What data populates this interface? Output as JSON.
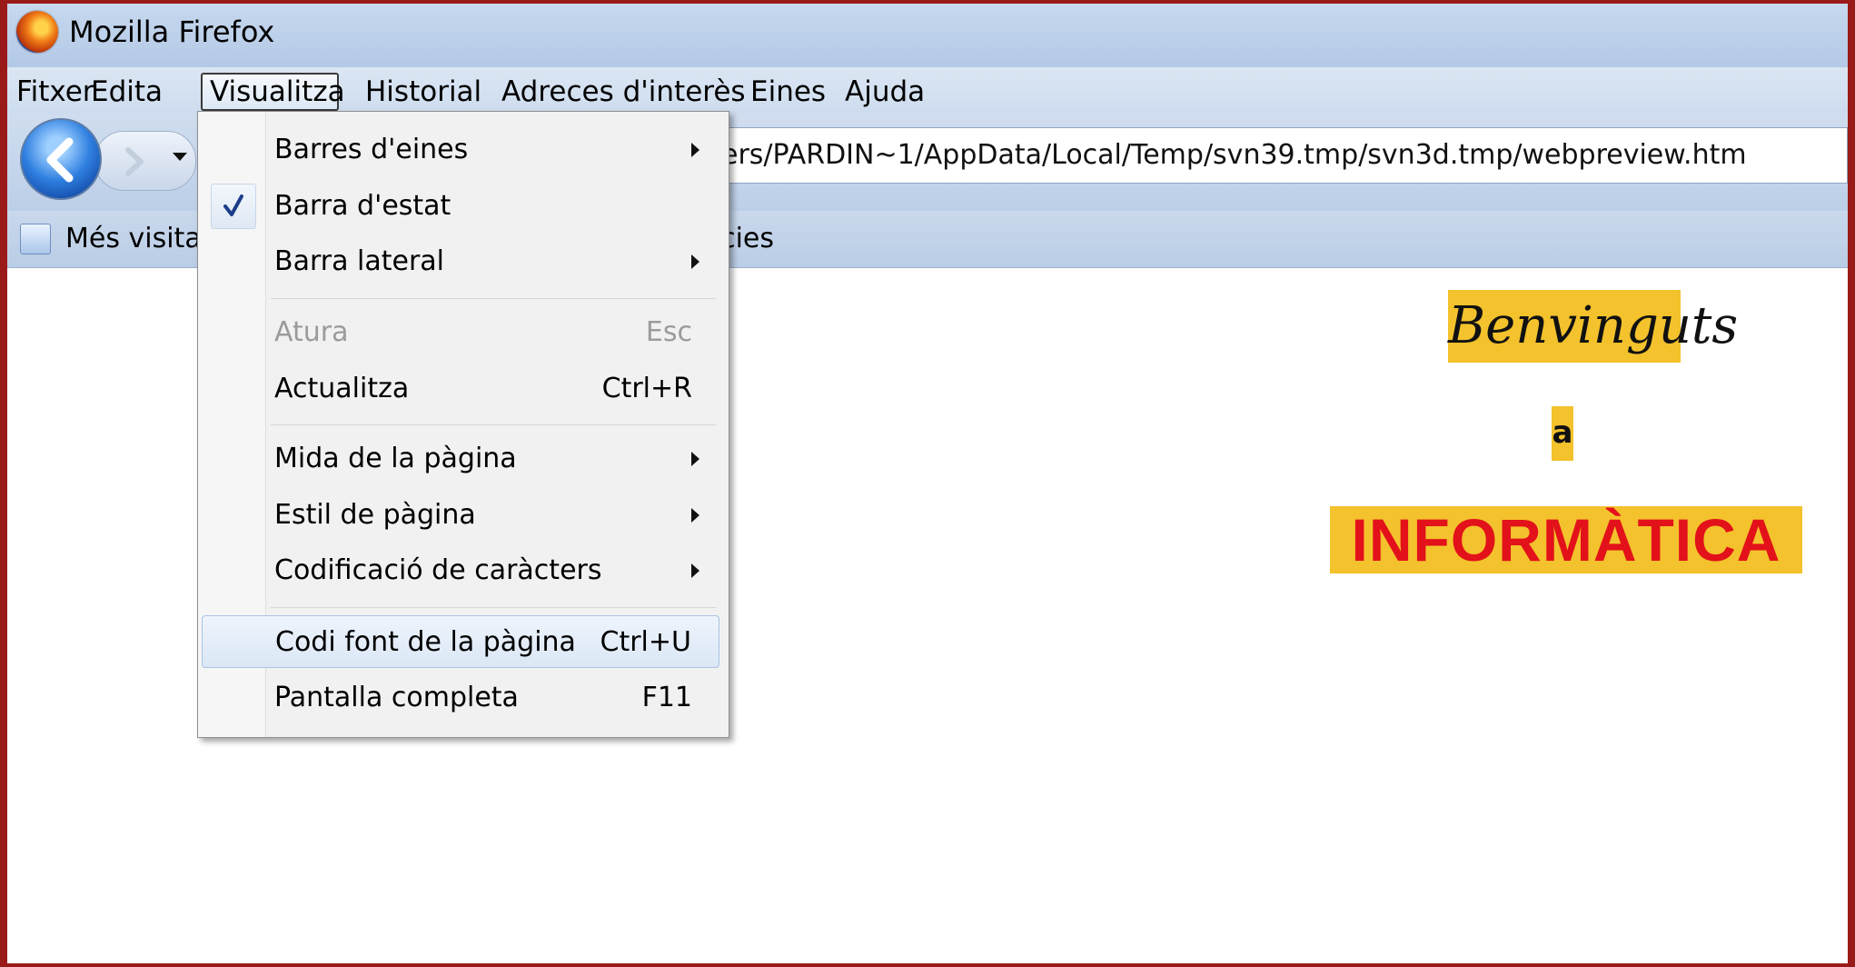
{
  "window": {
    "title": "Mozilla Firefox"
  },
  "menubar": {
    "items": [
      "Fitxer",
      "Edita",
      "Visualitza",
      "Historial",
      "Adreces d'interès",
      "Eines",
      "Ajuda"
    ]
  },
  "toolbar": {
    "url_visible": "ers/PARDIN~1/AppData/Local/Temp/svn39.tmp/svn3d.tmp/webpreview.htm"
  },
  "bookmarks": {
    "most_visited_visible": "Més visitad",
    "news_visible": "cies"
  },
  "view_menu": {
    "items": [
      {
        "label": "Barres d'eines",
        "shortcut": "",
        "submenu": true
      },
      {
        "label": "Barra d'estat",
        "shortcut": "",
        "checked": true
      },
      {
        "label": "Barra lateral",
        "shortcut": "",
        "submenu": true
      },
      {
        "label": "Atura",
        "shortcut": "Esc",
        "disabled": true
      },
      {
        "label": "Actualitza",
        "shortcut": "Ctrl+R"
      },
      {
        "label": "Mida de la pàgina",
        "shortcut": "",
        "submenu": true
      },
      {
        "label": "Estil de pàgina",
        "shortcut": "",
        "submenu": true
      },
      {
        "label": "Codificació de caràcters",
        "shortcut": "",
        "submenu": true
      },
      {
        "label": "Codi font de la pàgina",
        "shortcut": "Ctrl+U",
        "highlighted": true
      },
      {
        "label": "Pantalla completa",
        "shortcut": "F11"
      }
    ],
    "check_mark": "✓"
  },
  "page": {
    "welcome": "Benvinguts",
    "connector": "a",
    "headline": "INFORMÀTICA"
  },
  "colors": {
    "highlight_yellow": "#f3c22c",
    "headline_red": "#e3111a",
    "window_border": "#9a1a1a"
  }
}
